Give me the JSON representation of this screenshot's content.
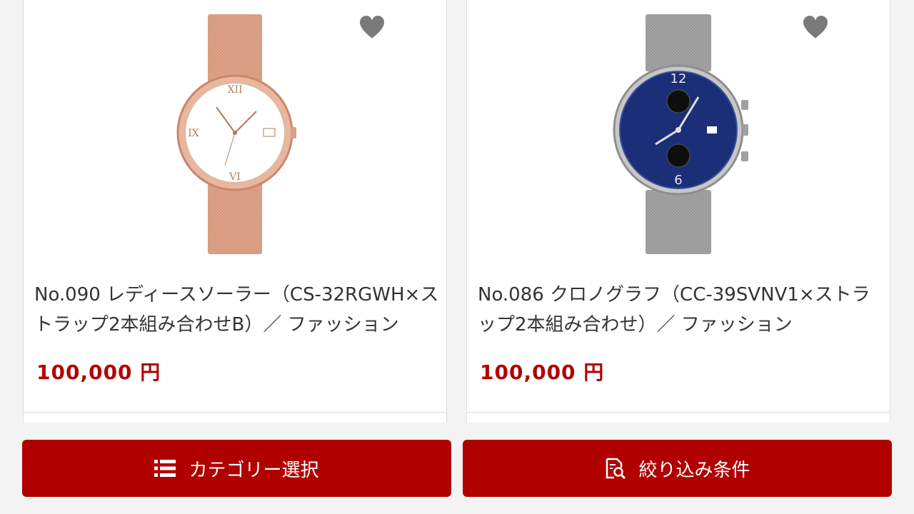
{
  "products": [
    {
      "title": "No.090 レディースソーラー（CS-32RGWH×ストラップ2本組み合わせB）／ ファッション",
      "price": "100,000 円",
      "image_icon": "rose-gold-watch-image",
      "favorite_icon": "heart-icon"
    },
    {
      "title": "No.086 クロノグラフ（CC-39SVNV1×ストラップ2本組み合わせ）／ ファッション",
      "price": "100,000 円",
      "image_icon": "silver-chronograph-watch-image",
      "favorite_icon": "heart-icon"
    }
  ],
  "bottom_bar": {
    "category_label": "カテゴリー選択",
    "category_icon": "list-icon",
    "filter_label": "絞り込み条件",
    "filter_icon": "filter-search-icon"
  },
  "colors": {
    "accent": "#b00000",
    "price": "#b30000",
    "favorite": "#7a7a7a"
  }
}
